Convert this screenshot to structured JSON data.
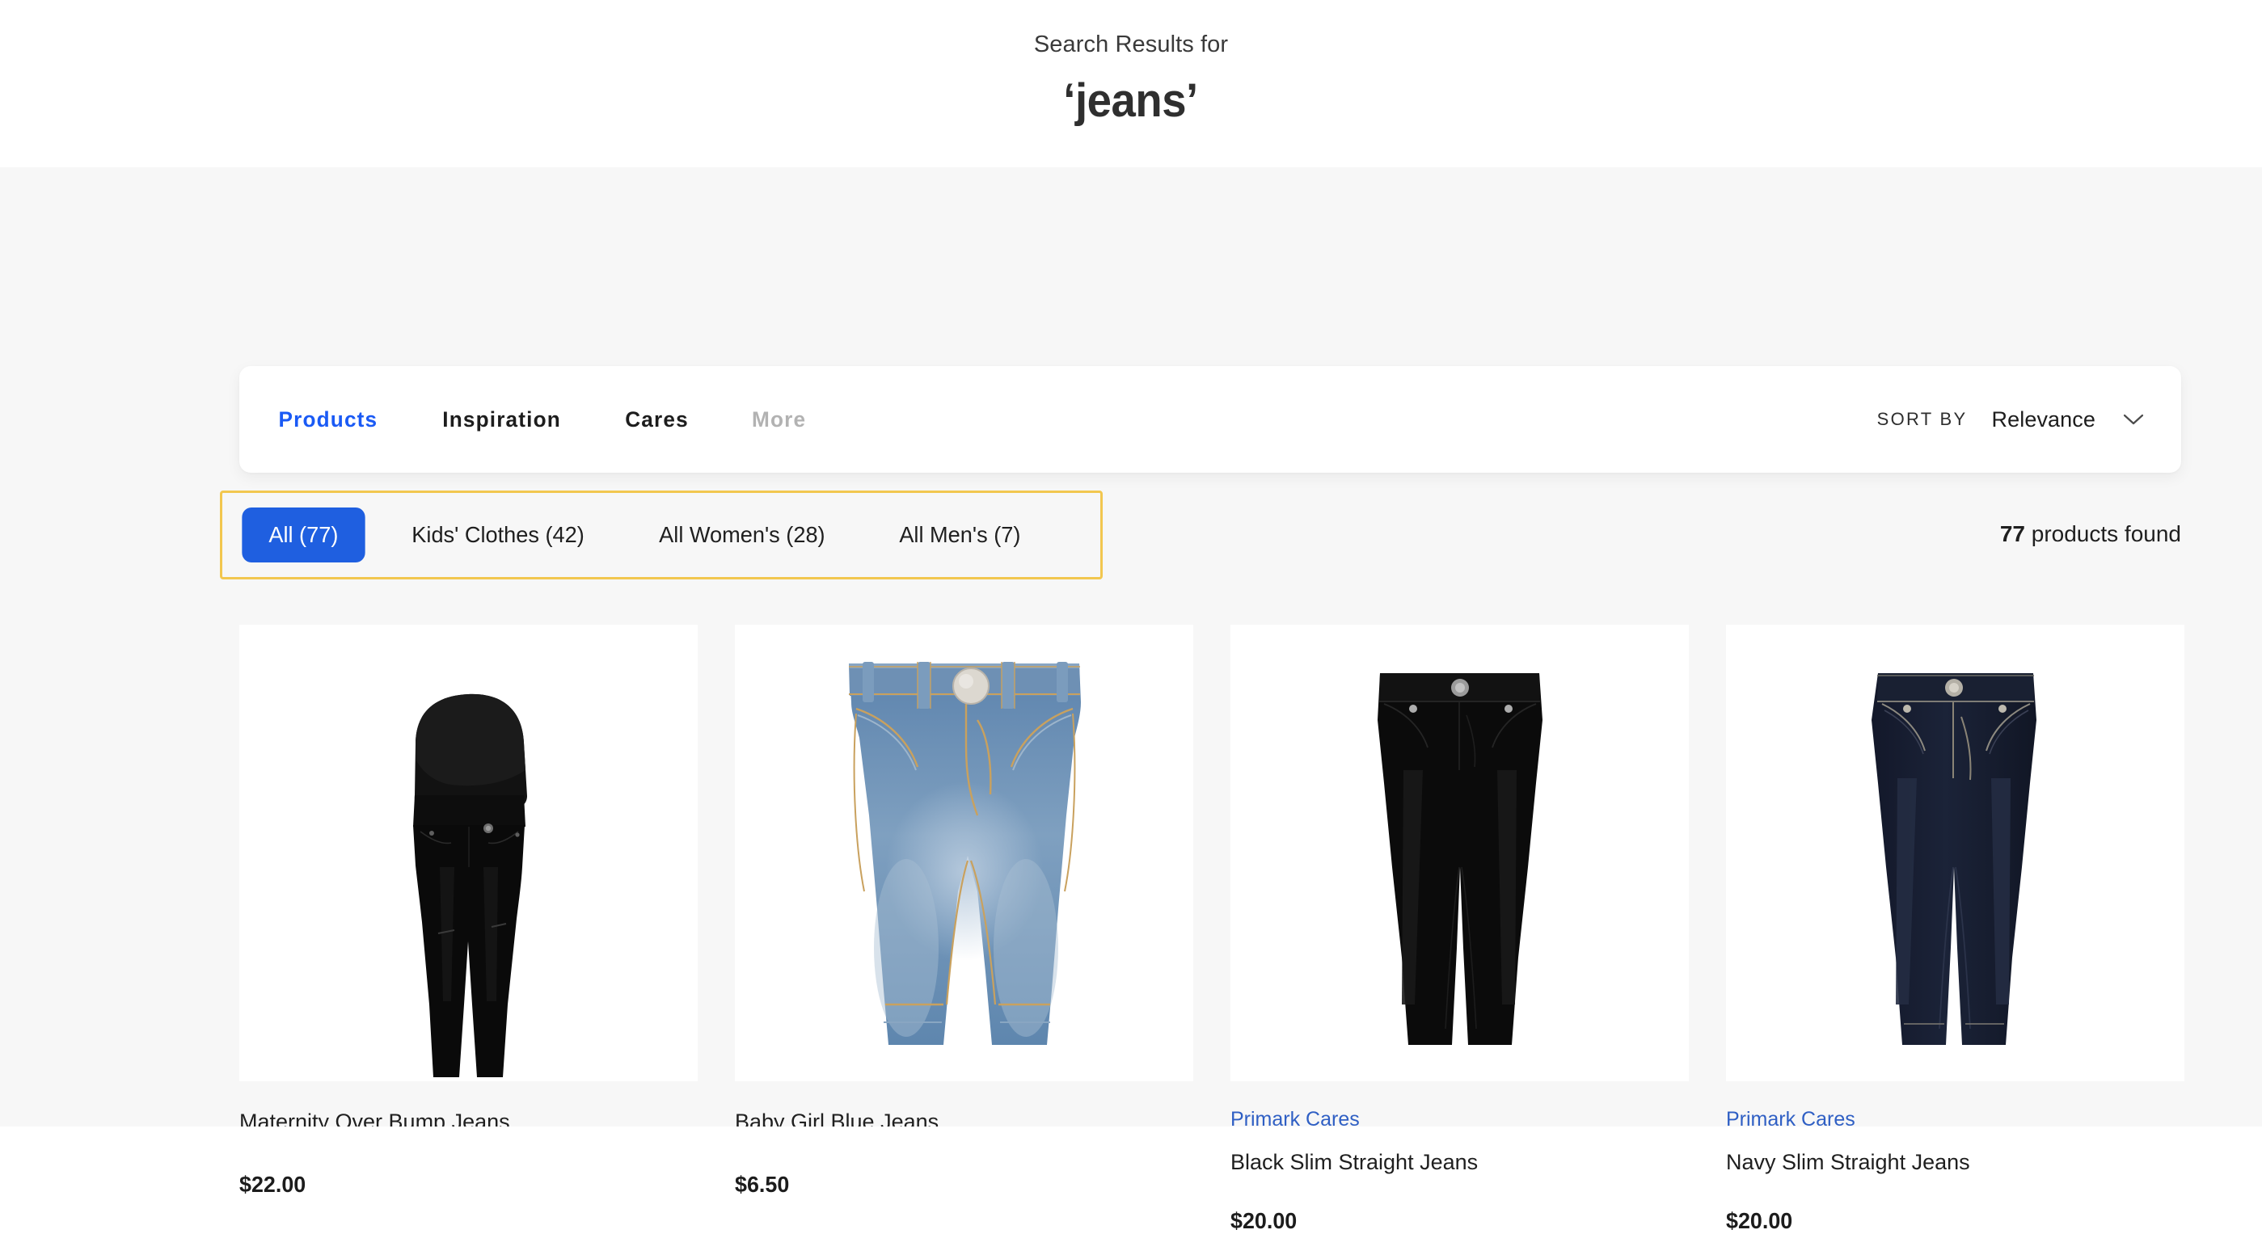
{
  "header": {
    "eyebrow": "Search Results for",
    "term": "‘jeans’"
  },
  "tabs": [
    {
      "label": "Products",
      "state": "active"
    },
    {
      "label": "Inspiration",
      "state": "normal"
    },
    {
      "label": "Cares",
      "state": "normal"
    },
    {
      "label": "More",
      "state": "muted"
    }
  ],
  "sort": {
    "label": "SORT BY",
    "value": "Relevance",
    "icon": "chevron-down-icon"
  },
  "filters": [
    {
      "label": "All (77)",
      "active": true
    },
    {
      "label": "Kids' Clothes (42)",
      "active": false
    },
    {
      "label": "All Women's (28)",
      "active": false
    },
    {
      "label": "All Men's (7)",
      "active": false
    }
  ],
  "results": {
    "count": "77",
    "count_suffix": " products found"
  },
  "products": [
    {
      "cares": "",
      "title": "Maternity Over Bump Jeans",
      "price": "$22.00",
      "image": "black-maternity-over-bump-jeans"
    },
    {
      "cares": "",
      "title": "Baby Girl Blue Jeans",
      "price": "$6.50",
      "image": "light-blue-baby-jeans"
    },
    {
      "cares": "Primark Cares",
      "title": "Black Slim Straight Jeans",
      "price": "$20.00",
      "image": "black-slim-straight-jeans"
    },
    {
      "cares": "Primark Cares",
      "title": "Navy Slim Straight Jeans",
      "price": "$20.00",
      "image": "navy-slim-straight-jeans"
    }
  ],
  "colors": {
    "accent_blue": "#1a5af5",
    "pill_blue": "#1f5fe0",
    "cares_blue": "#2f5fc4",
    "highlight_yellow": "#f2c74f",
    "page_bg": "#f7f7f7",
    "text_dark": "#1f1f1f",
    "muted_grey": "#b2b2b2"
  }
}
